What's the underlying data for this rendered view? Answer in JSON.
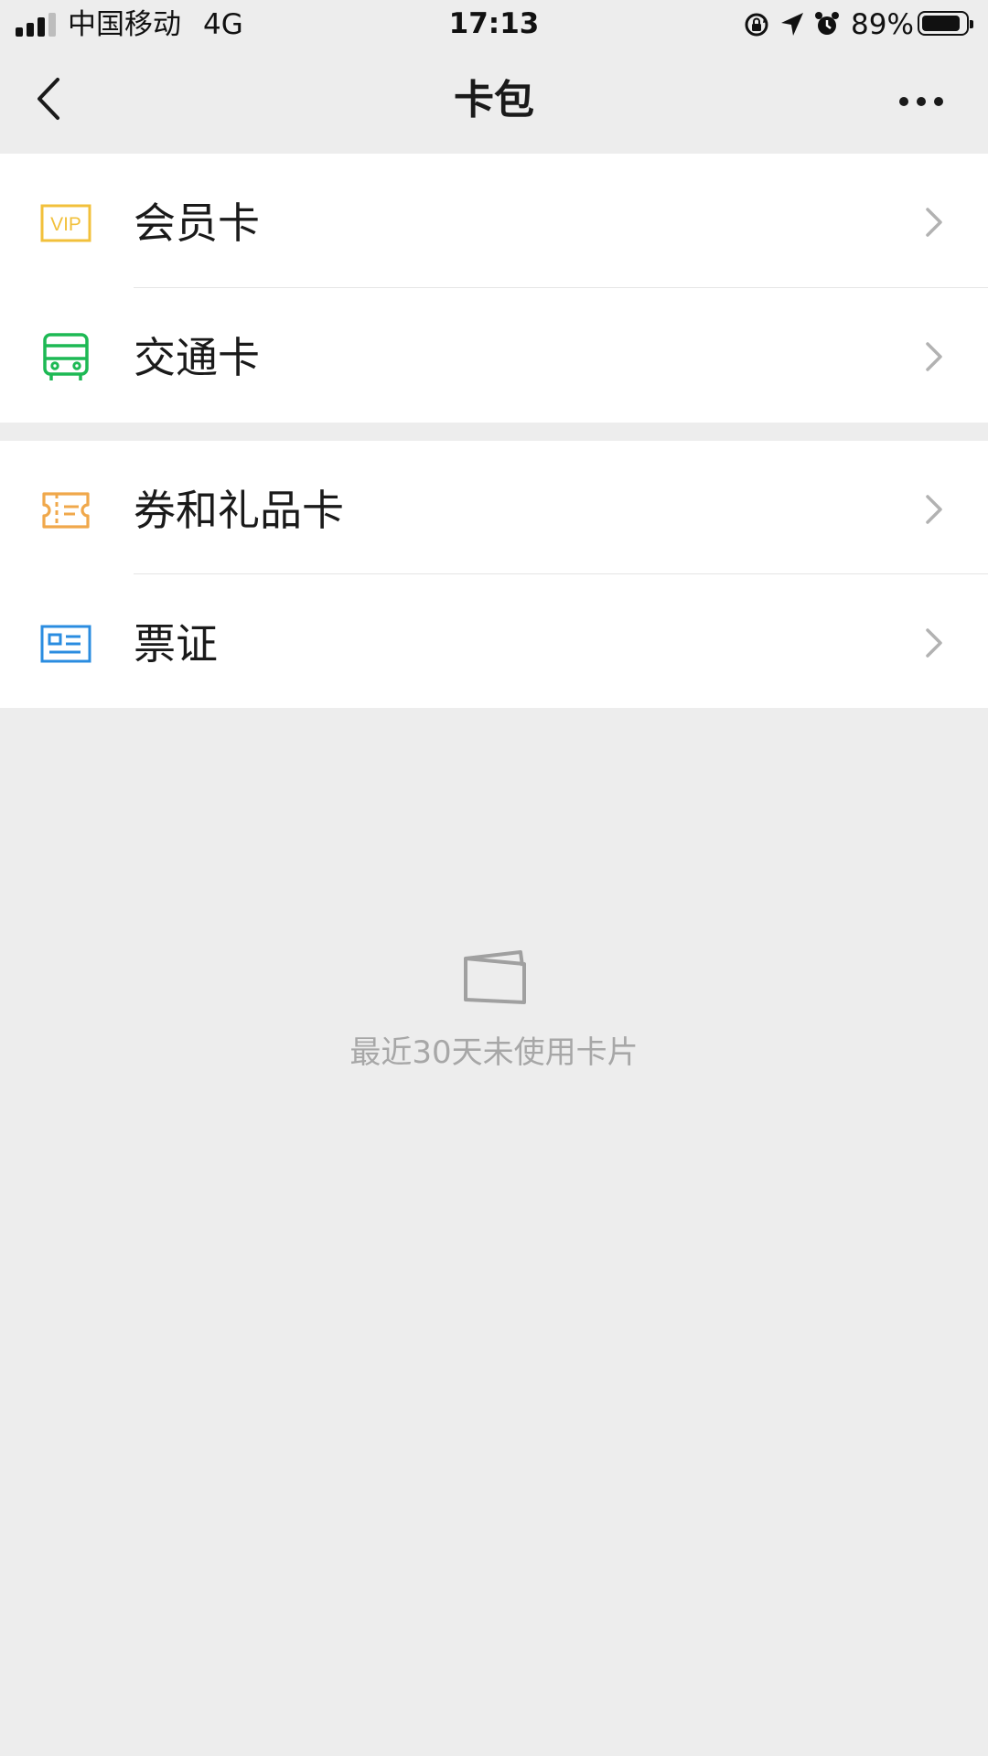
{
  "status_bar": {
    "carrier": "中国移动",
    "network": "4G",
    "time": "17:13",
    "battery_percent": "89%",
    "battery_level": 0.89,
    "icons": [
      "rotation-lock-icon",
      "location-arrow-icon",
      "alarm-icon"
    ]
  },
  "nav": {
    "title": "卡包",
    "back_icon": "chevron-left-icon",
    "more_icon": "more-dots-icon"
  },
  "groups": [
    {
      "items": [
        {
          "label": "会员卡",
          "icon": "vip-card-icon",
          "icon_text": "VIP",
          "icon_color": "#f2c03b"
        },
        {
          "label": "交通卡",
          "icon": "bus-icon",
          "icon_color": "#1db954"
        }
      ]
    },
    {
      "items": [
        {
          "label": "券和礼品卡",
          "icon": "coupon-ticket-icon",
          "icon_color": "#f0a84b"
        },
        {
          "label": "票证",
          "icon": "id-card-icon",
          "icon_color": "#2a8ce0"
        }
      ]
    }
  ],
  "empty_state": {
    "icon": "empty-card-icon",
    "text": "最近30天未使用卡片"
  },
  "colors": {
    "background": "#ededed",
    "row_background": "#ffffff",
    "chevron": "#b2b2b2",
    "empty_text": "#a7a7a7"
  }
}
